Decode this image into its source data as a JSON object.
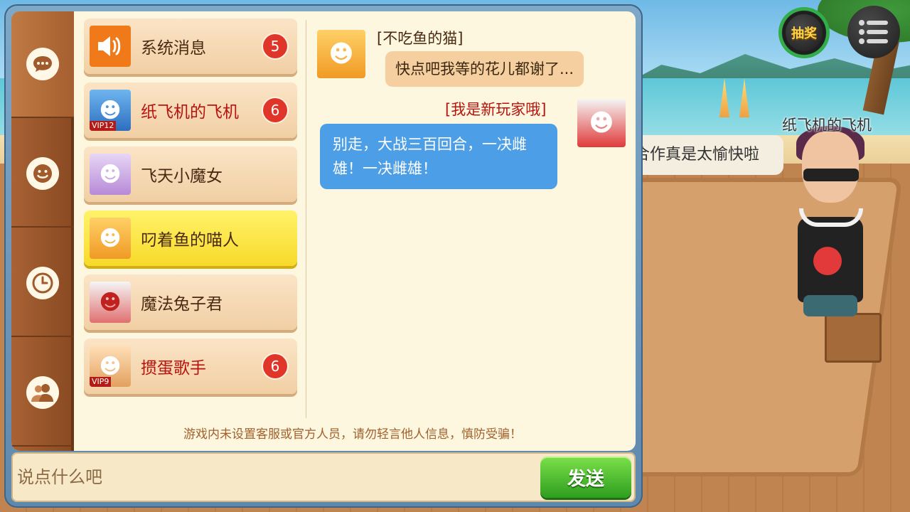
{
  "hud": {
    "lottery_label": "抽奖"
  },
  "scene": {
    "player_name": "纸飞机的飞机",
    "player_speech": "合作真是太愉快啦"
  },
  "tabs": [
    {
      "icon": "chat-bubble-icon"
    },
    {
      "icon": "smiley-icon"
    },
    {
      "icon": "clock-icon"
    },
    {
      "icon": "friends-icon"
    }
  ],
  "contacts": [
    {
      "name": "系统消息",
      "badge": "5",
      "vip": "",
      "avatar": "speaker-icon",
      "color": "#f07a1a"
    },
    {
      "name": "纸飞机的飞机",
      "badge": "6",
      "vip": "VIP12",
      "avatar": "avatar-blue-hair",
      "color": "#4a8fd8"
    },
    {
      "name": "飞天小魔女",
      "badge": "",
      "vip": "",
      "avatar": "avatar-witch",
      "color": "#c9a6e6"
    },
    {
      "name": "叼着鱼的喵人",
      "badge": "",
      "vip": "",
      "avatar": "avatar-fox",
      "color": "#f2a73b"
    },
    {
      "name": "魔法兔子君",
      "badge": "",
      "vip": "",
      "avatar": "avatar-rabbit",
      "color": "#d84040"
    },
    {
      "name": "掼蛋歌手",
      "badge": "6",
      "vip": "VIP9",
      "avatar": "avatar-goggles",
      "color": "#e6b27a"
    }
  ],
  "messages": [
    {
      "sender": "[不吃鱼的猫]",
      "text": "快点吧我等的花儿都谢了...",
      "side": "left"
    },
    {
      "sender": "[我是新玩家哦]",
      "text": "别走，大战三百回合，一决雌雄！一决雌雄！",
      "side": "right"
    }
  ],
  "notice": "游戏内未设置客服或官方人员，请勿轻言他人信息，慎防受骗！",
  "input": {
    "placeholder": "说点什么吧",
    "send_label": "发送"
  },
  "colors": {
    "accent_green": "#2e9e1f",
    "badge_red": "#e0362a",
    "vip_name_red": "#b8130e",
    "bubble_blue": "#4c9ee6"
  }
}
